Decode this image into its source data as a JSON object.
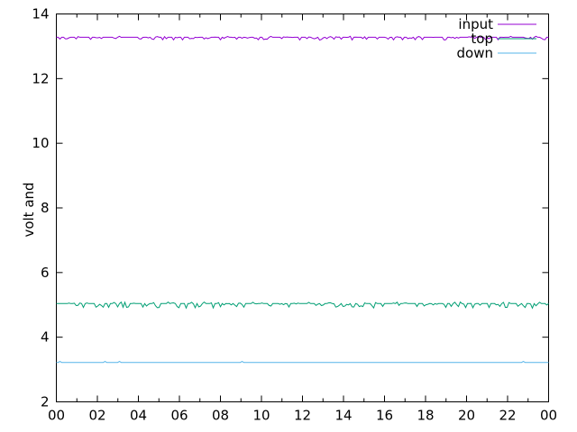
{
  "chart_data": {
    "type": "line",
    "title": "",
    "xlabel": "",
    "ylabel": "volt and",
    "x_tick_labels": [
      "00",
      "02",
      "04",
      "06",
      "08",
      "10",
      "12",
      "14",
      "16",
      "18",
      "20",
      "22",
      "00"
    ],
    "y_tick_labels": [
      "2",
      "4",
      "6",
      "8",
      "10",
      "12",
      "14"
    ],
    "xlim_hours": [
      0,
      24
    ],
    "ylim": [
      2,
      14
    ],
    "x_major_step_hours": 2,
    "x_minor_ticks_per_major": 1,
    "grid": false,
    "legend_position": "inside top right",
    "axis_color": "#000000",
    "text_color": "#000000",
    "background_color": "#ffffff",
    "series": [
      {
        "name": "input",
        "color": "#9400D3",
        "style": "noisy-flat",
        "mean": 13.28,
        "min": 13.19,
        "max": 13.31,
        "description": "nearly constant noisy line at ~13.3 volts across full 24h span"
      },
      {
        "name": "top",
        "color": "#009E73",
        "style": "noisy-flat",
        "mean": 5.04,
        "min": 4.9,
        "max": 5.09,
        "description": "nearly constant noisy line at ~5.0 volts across full 24h span"
      },
      {
        "name": "down",
        "color": "#56B4E9",
        "style": "flat",
        "mean": 3.22,
        "min": 3.22,
        "max": 3.25,
        "description": "flat line at ~3.25 volts across full 24h span with rare tiny blips"
      }
    ]
  }
}
